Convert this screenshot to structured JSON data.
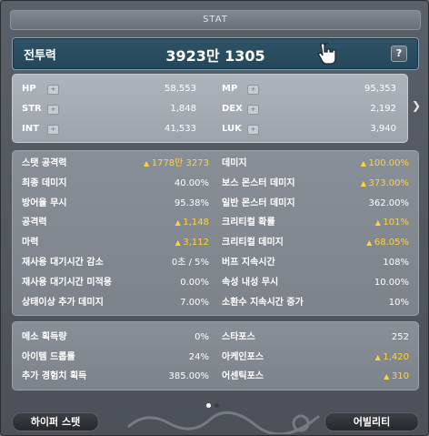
{
  "window": {
    "title": "STAT"
  },
  "power": {
    "label": "전투력",
    "value": "3923만 1305",
    "help": "?"
  },
  "base_stats": [
    {
      "name": "HP",
      "value": "58,553"
    },
    {
      "name": "MP",
      "value": "95,353"
    },
    {
      "name": "STR",
      "value": "1,848"
    },
    {
      "name": "DEX",
      "value": "2,192"
    },
    {
      "name": "INT",
      "value": "41,533"
    },
    {
      "name": "LUK",
      "value": "3,940"
    }
  ],
  "detail_left": [
    {
      "name": "스탯 공격력",
      "value": "1778만 3273",
      "up": true
    },
    {
      "name": "최종 데미지",
      "value": "40.00%",
      "up": false
    },
    {
      "name": "방어율 무시",
      "value": "95.38%",
      "up": false
    },
    {
      "name": "공격력",
      "value": "1,148",
      "up": true
    },
    {
      "name": "마력",
      "value": "3,112",
      "up": true
    },
    {
      "name": "재사용 대기시간 감소",
      "value": "0초 / 5%",
      "up": false
    },
    {
      "name": "재사용 대기시간 미적용",
      "value": "0.00%",
      "up": false
    },
    {
      "name": "상태이상 추가 데미지",
      "value": "7.00%",
      "up": false
    }
  ],
  "detail_right": [
    {
      "name": "데미지",
      "value": "100.00%",
      "up": true
    },
    {
      "name": "보스 몬스터 데미지",
      "value": "373.00%",
      "up": true
    },
    {
      "name": "일반 몬스터 데미지",
      "value": "362.00%",
      "up": false
    },
    {
      "name": "크리티컬 확률",
      "value": "101%",
      "up": true
    },
    {
      "name": "크리티컬 데미지",
      "value": "68.05%",
      "up": true
    },
    {
      "name": "버프 지속시간",
      "value": "108%",
      "up": false
    },
    {
      "name": "속성 내성 무시",
      "value": "10.00%",
      "up": false
    },
    {
      "name": "소환수 지속시간 증가",
      "value": "10%",
      "up": false
    }
  ],
  "extra_left": [
    {
      "name": "메소 획득량",
      "value": "0%",
      "up": false
    },
    {
      "name": "아이템 드롭률",
      "value": "24%",
      "up": false
    },
    {
      "name": "추가 경험치 획득",
      "value": "385.00%",
      "up": false
    }
  ],
  "extra_right": [
    {
      "name": "스타포스",
      "value": "252",
      "up": false
    },
    {
      "name": "아케인포스",
      "value": "1,420",
      "up": true
    },
    {
      "name": "어센틱포스",
      "value": "310",
      "up": true
    }
  ],
  "buttons": {
    "hyper_stat": "하이퍼 스탯",
    "ability": "어빌리티"
  },
  "pager": {
    "total": 2,
    "active": 0
  },
  "colors": {
    "accent": "#ffd23c",
    "power_bg": "#2f5366",
    "text": "#ffffff"
  },
  "icons": {
    "cursor": "hand-pointer-icon",
    "expand": "chevron-right-icon",
    "stat_up": "triangle-up-icon"
  }
}
